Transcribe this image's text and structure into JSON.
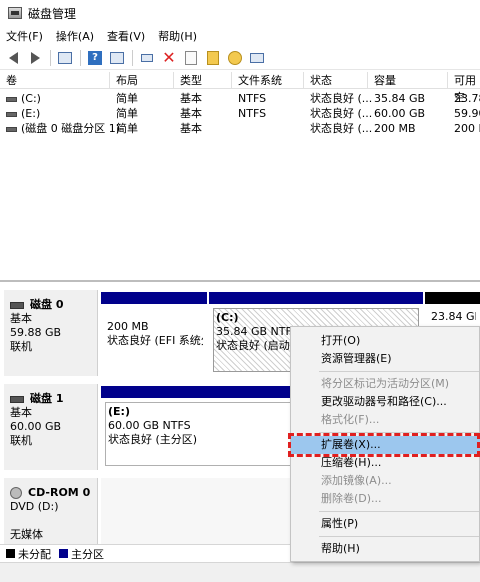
{
  "window": {
    "title": "磁盘管理"
  },
  "menu": [
    "文件(F)",
    "操作(A)",
    "查看(V)",
    "帮助(H)"
  ],
  "toolbar": {
    "icons": [
      "back-arrow-icon",
      "forward-arrow-icon",
      "console-tree-icon",
      "help-icon",
      "properties-icon",
      "connect-icon",
      "delete-icon",
      "check-icon",
      "refresh-icon",
      "rescan-icon",
      "settings-icon"
    ]
  },
  "volume_list": {
    "columns": [
      "卷",
      "布局",
      "类型",
      "文件系统",
      "状态",
      "容量",
      "可用空"
    ],
    "rows": [
      [
        "(C:)",
        "简单",
        "基本",
        "NTFS",
        "状态良好 (...",
        "35.84 GB",
        "23.78"
      ],
      [
        "(E:)",
        "简单",
        "基本",
        "NTFS",
        "状态良好 (...",
        "60.00 GB",
        "59.90"
      ],
      [
        "(磁盘 0 磁盘分区 1)",
        "简单",
        "基本",
        "",
        "状态良好 (...",
        "200 MB",
        "200 M"
      ]
    ]
  },
  "disks": [
    {
      "name": "磁盘 0",
      "type": "基本",
      "size": "59.88 GB",
      "status": "联机",
      "partitions": [
        {
          "title": "",
          "line1": "200 MB",
          "line2": "状态良好 (EFI 系统分"
        },
        {
          "title": "(C:)",
          "line1": "35.84 GB NTFS",
          "line2": "状态良好 (启动, 页"
        },
        {
          "title": "",
          "line1": "23.84 GB",
          "line2": ""
        }
      ]
    },
    {
      "name": "磁盘 1",
      "type": "基本",
      "size": "60.00 GB",
      "status": "联机",
      "partitions": [
        {
          "title": "(E:)",
          "line1": "60.00 GB NTFS",
          "line2": "状态良好 (主分区)"
        }
      ]
    },
    {
      "name": "CD-ROM 0",
      "type": "DVD (D:)",
      "size": "",
      "status": "无媒体",
      "partitions": []
    }
  ],
  "legend": [
    {
      "label": "未分配",
      "color": "#000000"
    },
    {
      "label": "主分区",
      "color": "#00008b"
    }
  ],
  "context_menu": {
    "items": [
      {
        "label": "打开(O)",
        "enabled": true
      },
      {
        "label": "资源管理器(E)",
        "enabled": true
      },
      {
        "label": "将分区标记为活动分区(M)",
        "enabled": false
      },
      {
        "label": "更改驱动器号和路径(C)...",
        "enabled": true
      },
      {
        "label": "格式化(F)...",
        "enabled": false
      },
      {
        "label": "扩展卷(X)...",
        "enabled": true,
        "highlighted": true
      },
      {
        "label": "压缩卷(H)...",
        "enabled": true
      },
      {
        "label": "添加镜像(A)...",
        "enabled": false
      },
      {
        "label": "删除卷(D)...",
        "enabled": false
      },
      {
        "label": "属性(P)",
        "enabled": true
      },
      {
        "label": "帮助(H)",
        "enabled": true
      }
    ]
  },
  "colors": {
    "primary_partition": "#00008b",
    "unallocated": "#000000",
    "menu_highlight": "#9cc7ee",
    "annotation_frame": "#e02020"
  }
}
